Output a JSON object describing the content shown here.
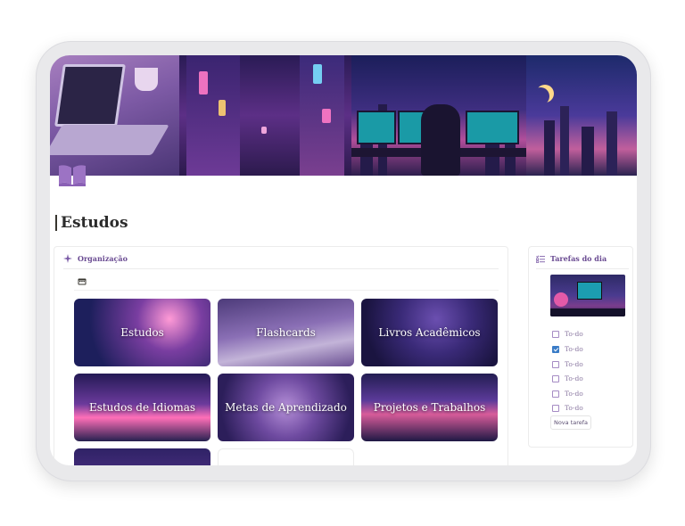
{
  "page": {
    "title": "Estudos"
  },
  "organizacao": {
    "header": "Organização",
    "cards": [
      {
        "label": "Estudos"
      },
      {
        "label": "Flashcards"
      },
      {
        "label": "Livros Acadêmicos"
      },
      {
        "label": "Estudos de Idiomas"
      },
      {
        "label": "Metas de Aprendizado"
      },
      {
        "label": "Projetos e Trabalhos"
      },
      {
        "label": ""
      },
      {
        "label": ""
      }
    ]
  },
  "tarefas": {
    "header": "Tarefas do dia",
    "items": [
      {
        "label": "To-do",
        "checked": false
      },
      {
        "label": "To-do",
        "checked": true
      },
      {
        "label": "To-do",
        "checked": false
      },
      {
        "label": "To-do",
        "checked": false
      },
      {
        "label": "To-do",
        "checked": false
      },
      {
        "label": "To-do",
        "checked": false
      }
    ],
    "new_task_label": "Nova tarefa"
  },
  "colors": {
    "accent": "#6a4b92",
    "check": "#3a7cc7"
  },
  "icons": {
    "page": "open-book-icon",
    "organizacao": "sparkle-icon",
    "gallery": "calendar-icon",
    "tarefas": "checklist-icon"
  }
}
